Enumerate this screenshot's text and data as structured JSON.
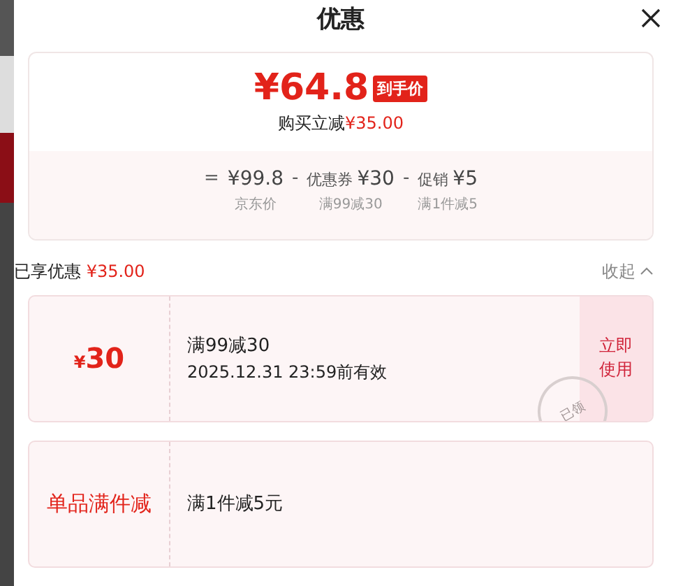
{
  "title": "优惠",
  "summary": {
    "price": "¥64.8",
    "price_tag": "到手价",
    "instant_label": "购买立减",
    "instant_amount": "¥35.00",
    "formula": [
      {
        "kind": "op",
        "text": "="
      },
      {
        "kind": "term",
        "amount": "¥99.8",
        "caption": "京东价"
      },
      {
        "kind": "op",
        "text": "-"
      },
      {
        "kind": "term",
        "label": "优惠券",
        "amount": "¥30",
        "caption": "满99减30"
      },
      {
        "kind": "op",
        "text": "-"
      },
      {
        "kind": "term",
        "label": "促销",
        "amount": "¥5",
        "caption": "满1件减5"
      }
    ]
  },
  "enjoyed": {
    "label": "已享优惠",
    "amount": "¥35.00",
    "collapse": "收起"
  },
  "offers": [
    {
      "kind": "coupon",
      "currency": "¥",
      "value": "30",
      "title": "满99减30",
      "validity": "2025.12.31 23:59前有效",
      "action": "立即使用",
      "stamp": "已领"
    },
    {
      "kind": "promotion",
      "name": "单品满件减",
      "title": "满1件减5元"
    }
  ]
}
